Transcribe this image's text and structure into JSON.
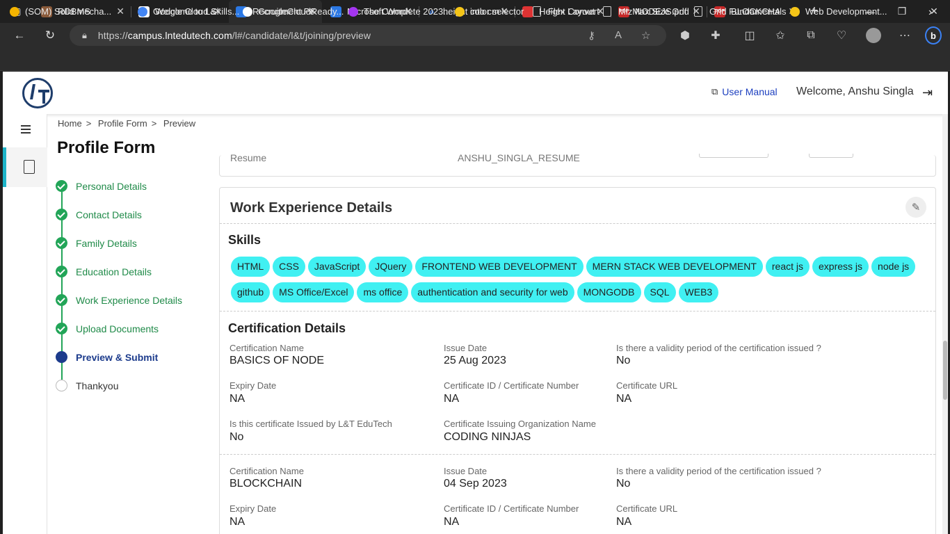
{
  "browser": {
    "tabs": [
      {
        "title": "RDBMS",
        "icon": "rdbms-favicon",
        "color": "#8a5a3a"
      },
      {
        "title": "Welcome to L&T",
        "icon": "gmail-favicon",
        "color": "#d93025"
      },
      {
        "title": "Recruitment Portal",
        "icon": "chart-favicon",
        "color": "#2b78e4"
      },
      {
        "title": "Microsoft Word",
        "icon": "chart-favicon",
        "color": "#2b78e4"
      },
      {
        "title": "height into cm",
        "icon": "search-favicon",
        "color": "#3b82f6"
      },
      {
        "title": "Height Converter",
        "icon": "calc-favicon",
        "color": "#d33"
      },
      {
        "title": "NODEJS.pdf",
        "icon": "pdf-favicon",
        "color": "#c62828"
      },
      {
        "title": "BLOCKCHAIN.pdf",
        "icon": "pdf-favicon",
        "color": "#c62828"
      }
    ],
    "url_prefix": "https://",
    "url_host": "campus.lntedutech.com",
    "url_path": "/l#/candidate/l&t/joining/preview",
    "bookmarks": [
      {
        "label": "(SOM) Solid mecha...",
        "icon": "google-cloud-icon",
        "color": "#f4b400"
      },
      {
        "label": "Google Cloud Skills...",
        "icon": "google-cloud-icon",
        "color": "#4285f4"
      },
      {
        "label": "GoogleCloudReady...",
        "icon": "google-icon",
        "color": "#ffffff"
      },
      {
        "label": "The Complete 2023...",
        "icon": "udemy-icon",
        "color": "#a435f0"
      },
      {
        "label": "color selector",
        "icon": "bookmark-icon",
        "color": "#f5c518"
      },
      {
        "label": "Flex Layout",
        "icon": "page-icon",
        "color": ""
      },
      {
        "label": "MizMax Size Grid",
        "icon": "page-icon",
        "color": ""
      },
      {
        "label": "Grid Fundamentals",
        "icon": "page-icon",
        "color": ""
      },
      {
        "label": "Web Development...",
        "icon": "bookmark-icon",
        "color": "#f5c518"
      }
    ]
  },
  "header": {
    "user_manual": "User Manual",
    "welcome": "Welcome, Anshu Singla"
  },
  "breadcrumb": [
    "Home",
    "Profile Form",
    "Preview"
  ],
  "breadcrumb_sep": ">",
  "page_title": "Profile Form",
  "steps": [
    {
      "label": "Personal Details",
      "state": "done"
    },
    {
      "label": "Contact Details",
      "state": "done"
    },
    {
      "label": "Family Details",
      "state": "done"
    },
    {
      "label": "Education Details",
      "state": "done"
    },
    {
      "label": "Work Experience Details",
      "state": "done"
    },
    {
      "label": "Upload Documents",
      "state": "done"
    },
    {
      "label": "Preview & Submit",
      "state": "current"
    },
    {
      "label": "Thankyou",
      "state": "todo"
    }
  ],
  "top_card": {
    "label": "Resume",
    "value": "ANSHU_SINGLA_RESUME"
  },
  "work": {
    "title": "Work Experience Details",
    "skills_title": "Skills",
    "skills": [
      "HTML",
      "CSS",
      "JavaScript",
      "JQuery",
      "FRONTEND WEB DEVELOPMENT",
      "MERN STACK WEB DEVELOPMENT",
      "react js",
      "express js",
      "node js",
      "github",
      "MS Office/Excel",
      "ms office",
      "authentication and security for web",
      "MONGODB",
      "SQL",
      "WEB3"
    ],
    "cert_title": "Certification Details",
    "labels": {
      "name": "Certification Name",
      "issue": "Issue Date",
      "validity": "Is there a validity period of the certification issued ?",
      "expiry": "Expiry Date",
      "cid": "Certificate ID / Certificate Number",
      "url": "Certificate URL",
      "lnt": "Is this certificate Issued by L&T EduTech",
      "org": "Certificate Issuing Organization Name"
    },
    "certs": [
      {
        "name": "BASICS OF NODE",
        "issue": "25 Aug 2023",
        "validity": "No",
        "expiry": "NA",
        "cid": "NA",
        "url": "NA",
        "lnt": "No",
        "org": "CODING NINJAS"
      },
      {
        "name": "BLOCKCHAIN",
        "issue": "04 Sep 2023",
        "validity": "No",
        "expiry": "NA",
        "cid": "NA",
        "url": "NA"
      }
    ]
  }
}
